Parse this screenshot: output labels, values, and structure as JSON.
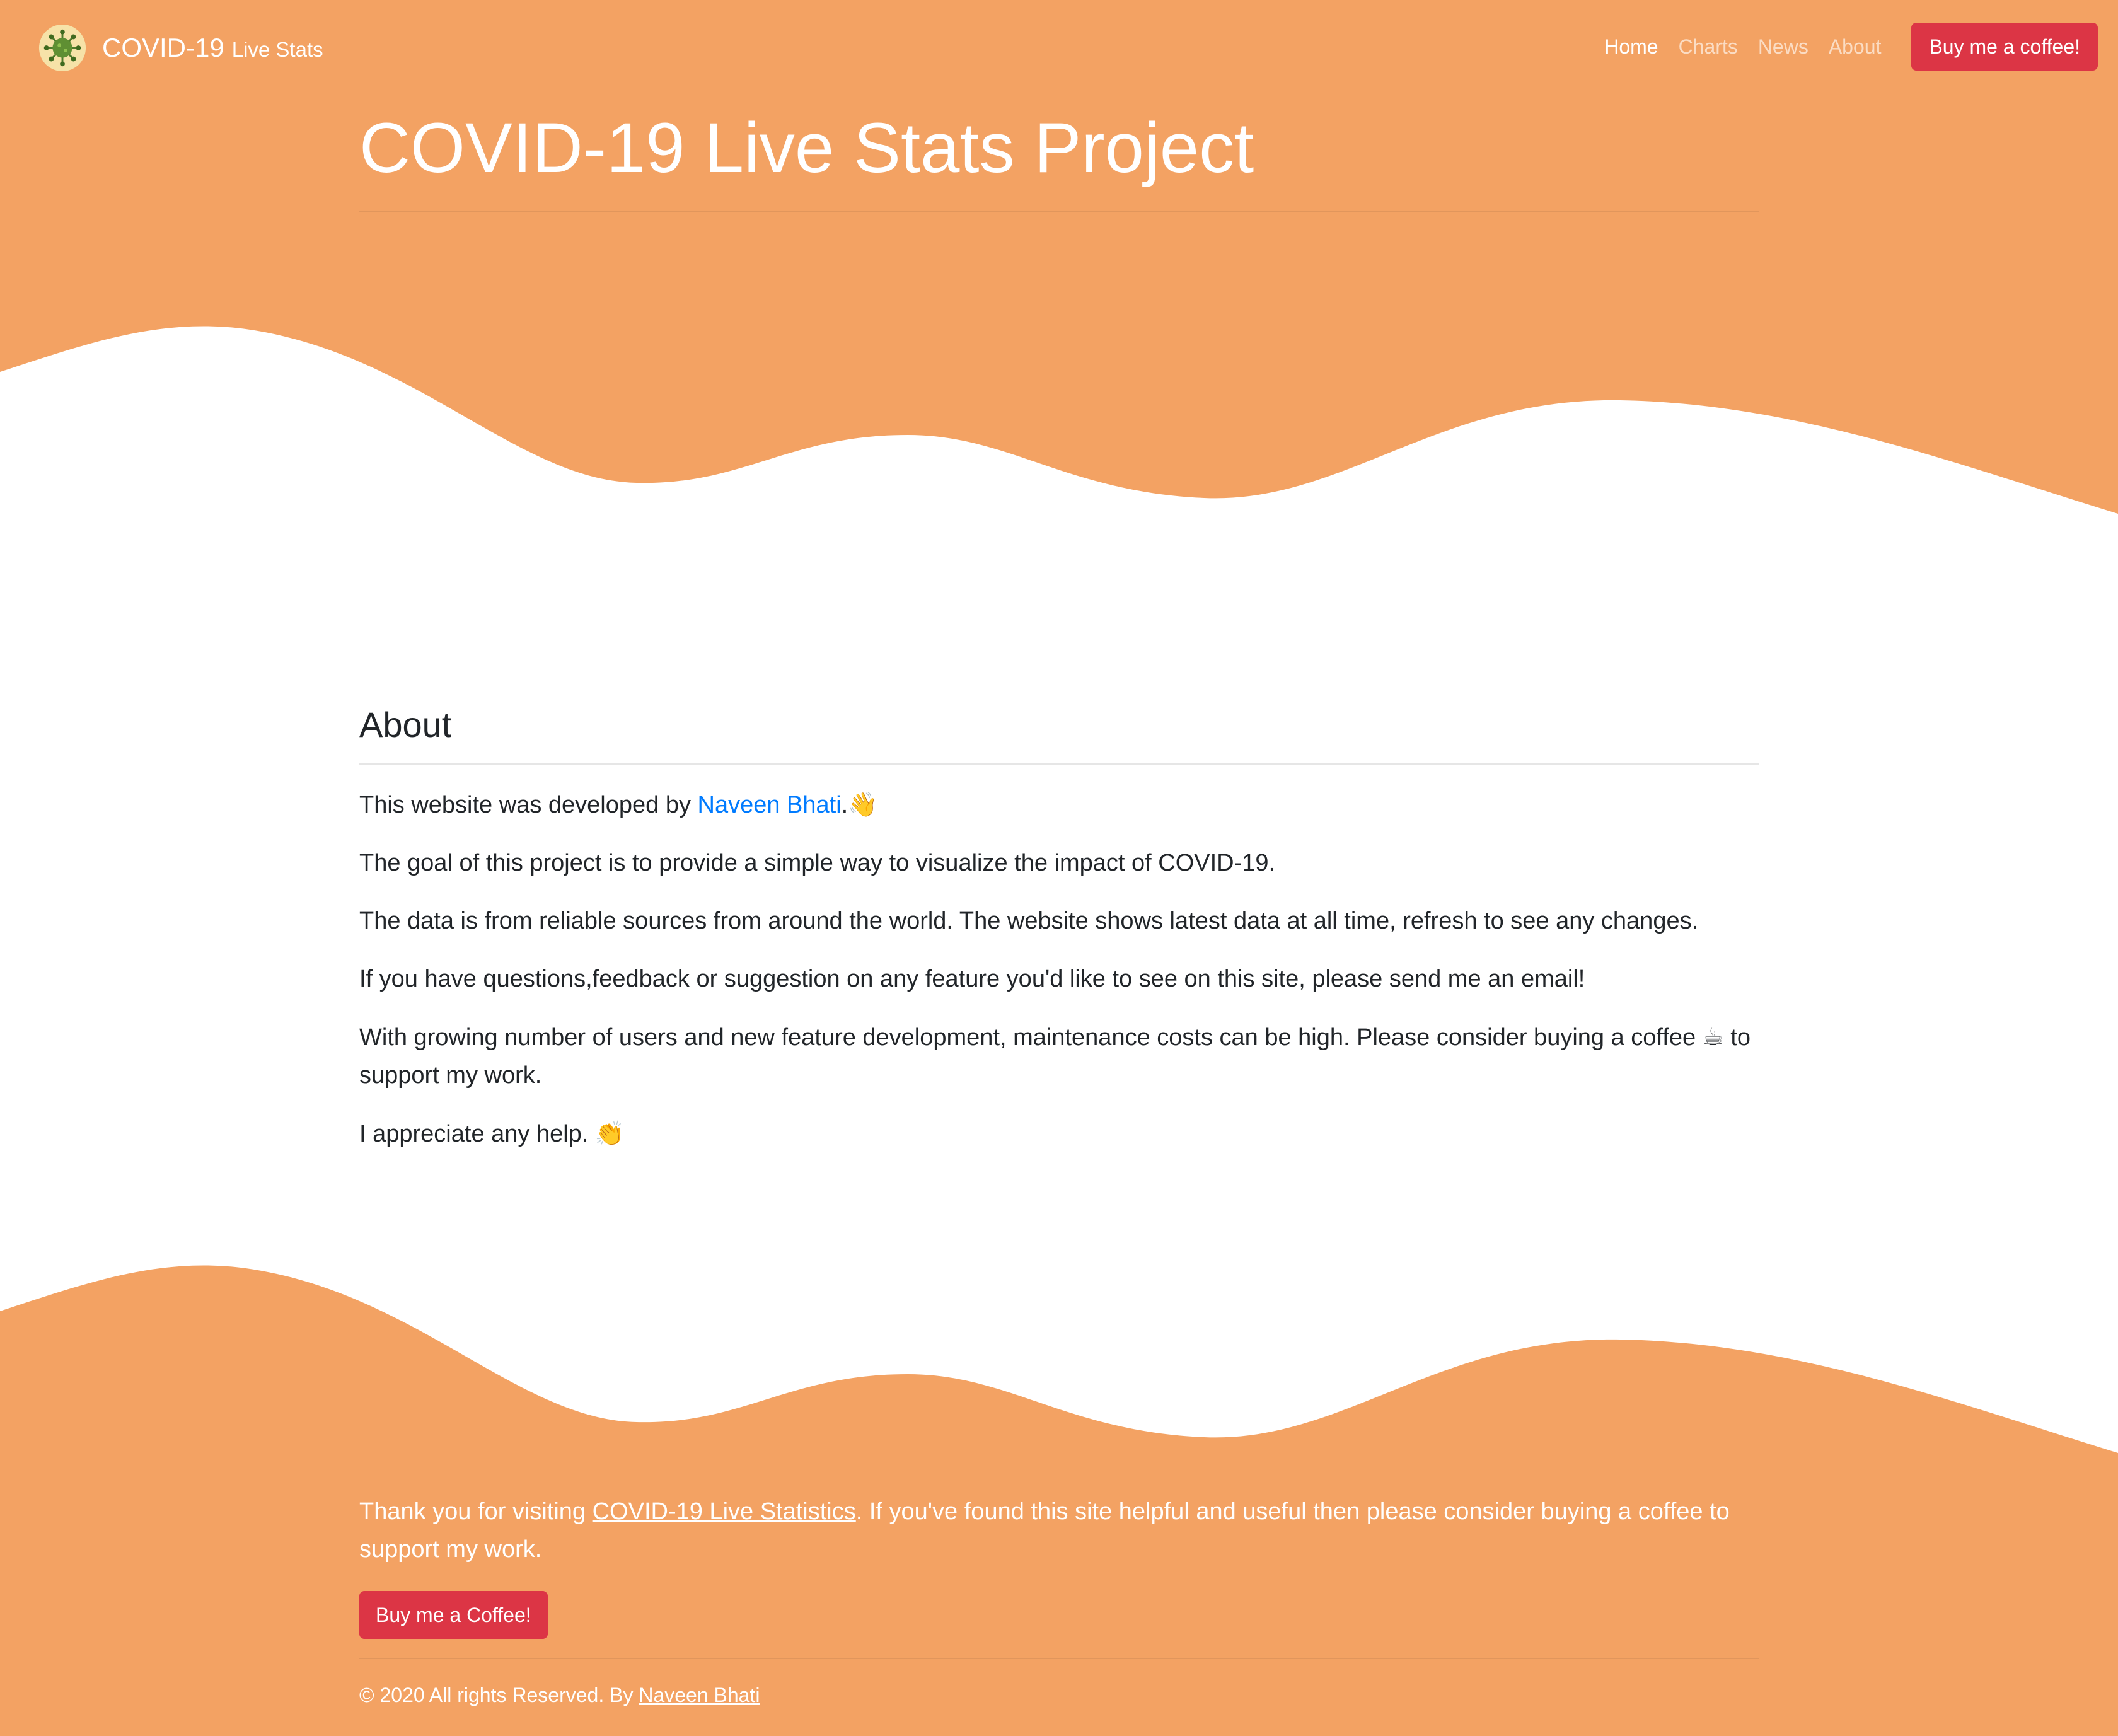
{
  "theme": {
    "brand_orange": "#f3a263",
    "button_red": "#dc3545",
    "link_blue": "#007bff"
  },
  "navbar": {
    "logo_icon": "virus-icon",
    "brand_main": "COVID-19",
    "brand_sub": "Live Stats",
    "links": [
      {
        "label": "Home",
        "active": true
      },
      {
        "label": "Charts",
        "active": false
      },
      {
        "label": "News",
        "active": false
      },
      {
        "label": "About",
        "active": false
      }
    ],
    "coffee_button": "Buy me a coffee!"
  },
  "hero": {
    "title": "COVID-19 Live Stats Project"
  },
  "about": {
    "heading": "About",
    "p1_prefix": "This website was developed by ",
    "p1_link": "Naveen Bhati",
    "p1_suffix": ".",
    "p1_emoji": "👋",
    "p2": "The goal of this project is to provide a simple way to visualize the impact of COVID-19.",
    "p3": "The data is from reliable sources from around the world. The website shows latest data at all time, refresh to see any changes.",
    "p4": "If you have questions,feedback or suggestion on any feature you'd like to see on this site, please send me an email!",
    "p5_prefix": "With growing number of users and new feature development, maintenance costs can be high. Please consider buying a coffee ",
    "p5_emoji": "☕",
    "p5_suffix": " to support my work.",
    "p6_text": "I appreciate any help. ",
    "p6_emoji": "👏"
  },
  "footer": {
    "thanks_prefix": "Thank you for visiting ",
    "thanks_link": "COVID-19 Live Statistics",
    "thanks_suffix": ". If you've found this site helpful and useful then please consider buying a coffee to support my work.",
    "coffee_button": "Buy me a Coffee!",
    "copyright_prefix": "© 2020 All rights Reserved. By ",
    "copyright_link": "Naveen Bhati"
  }
}
